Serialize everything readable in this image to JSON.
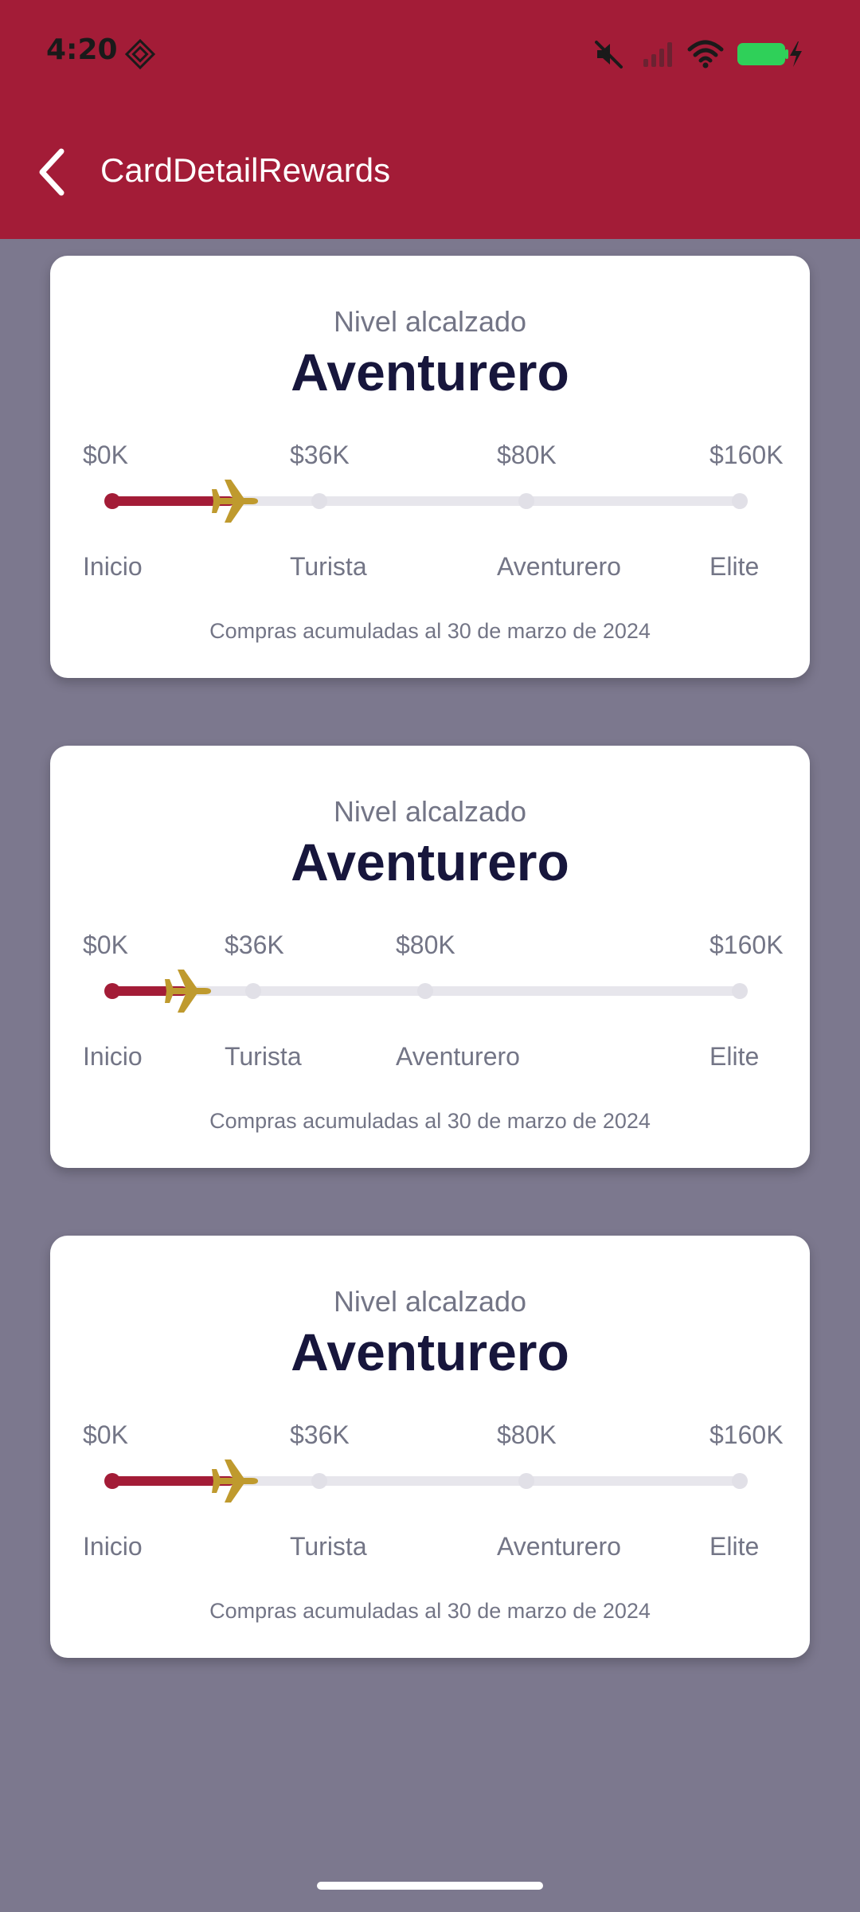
{
  "status_bar": {
    "time": "4:20"
  },
  "header": {
    "title": "CardDetailRewards"
  },
  "cards": [
    {
      "subtitle": "Nivel alcalzado",
      "title": "Aventurero",
      "progress_fraction": 0.195,
      "tiers": [
        {
          "amount": "$0K",
          "level": "Inicio"
        },
        {
          "amount": "$36K",
          "level": "Turista"
        },
        {
          "amount": "$80K",
          "level": "Aventurero"
        },
        {
          "amount": "$160K",
          "level": "Elite"
        }
      ],
      "footer": "Compras acumuladas al 30 de marzo de 2024"
    },
    {
      "subtitle": "Nivel alcalzado",
      "title": "Aventurero",
      "progress_fraction": 0.12,
      "tiers": [
        {
          "amount": "$0K",
          "level": "Inicio"
        },
        {
          "amount": "$36K",
          "level": "Turista"
        },
        {
          "amount": "$80K",
          "level": "Aventurero"
        },
        {
          "amount": "$160K",
          "level": "Elite"
        }
      ],
      "footer": "Compras acumuladas al 30 de marzo de 2024"
    },
    {
      "subtitle": "Nivel alcalzado",
      "title": "Aventurero",
      "progress_fraction": 0.195,
      "tiers": [
        {
          "amount": "$0K",
          "level": "Inicio"
        },
        {
          "amount": "$36K",
          "level": "Turista"
        },
        {
          "amount": "$80K",
          "level": "Aventurero"
        },
        {
          "amount": "$160K",
          "level": "Elite"
        }
      ],
      "footer": "Compras acumuladas al 30 de marzo de 2024"
    }
  ],
  "colors": {
    "header": "#a31c37",
    "progress": "#a31c37",
    "plane": "#bf9a2e",
    "background": "#7c788e",
    "title_text": "#17163c"
  },
  "icons": {
    "back": "chevron-left-icon",
    "progress_marker": "airplane-icon",
    "status": [
      "app-diamond-icon",
      "mute-icon",
      "signal-icon",
      "wifi-icon",
      "battery-charging-icon"
    ]
  }
}
